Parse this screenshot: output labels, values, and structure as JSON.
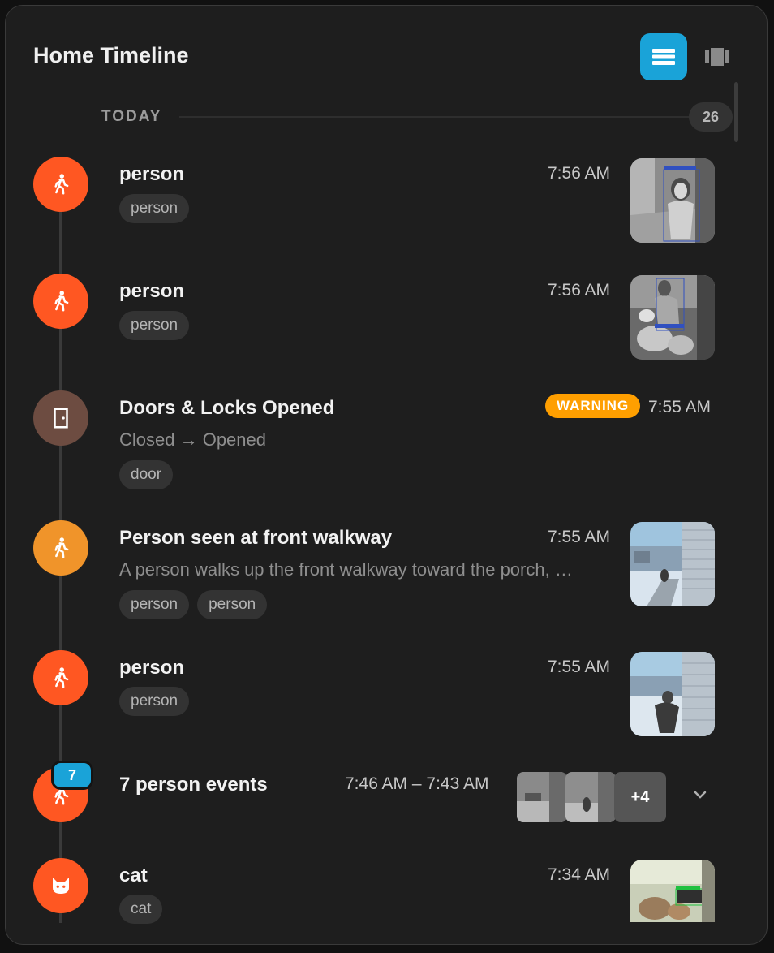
{
  "header": {
    "title": "Home Timeline"
  },
  "day": {
    "label": "TODAY",
    "count": "26"
  },
  "colors": {
    "person_orange": "#ff5722",
    "person_amber": "#f0942a",
    "door_brown": "#6d4c41",
    "accent_blue": "#1aa3d8",
    "warning": "#ff9f00"
  },
  "events": [
    {
      "icon": "person-walking-icon",
      "title": "person",
      "time": "7:56 AM",
      "chips": [
        "person"
      ]
    },
    {
      "icon": "person-walking-icon",
      "title": "person",
      "time": "7:56 AM",
      "chips": [
        "person"
      ]
    },
    {
      "icon": "door-icon",
      "title": "Doors & Locks Opened",
      "badge": "WARNING",
      "time": "7:55 AM",
      "description": "Closed → Opened",
      "chips": [
        "door"
      ]
    },
    {
      "icon": "person-walking-icon",
      "title": "Person seen at front walkway",
      "time": "7:55 AM",
      "description": "A person walks up the front walkway toward the porch, …",
      "chips": [
        "person",
        "person"
      ]
    },
    {
      "icon": "person-walking-icon",
      "title": "person",
      "time": "7:55 AM",
      "chips": [
        "person"
      ]
    },
    {
      "icon": "cat-icon",
      "title": "cat",
      "time": "7:34 AM",
      "chips": [
        "cat"
      ]
    }
  ],
  "group": {
    "count": "7",
    "title": "7 person events",
    "time_range": "7:46 AM – 7:43 AM",
    "more": "+4"
  }
}
